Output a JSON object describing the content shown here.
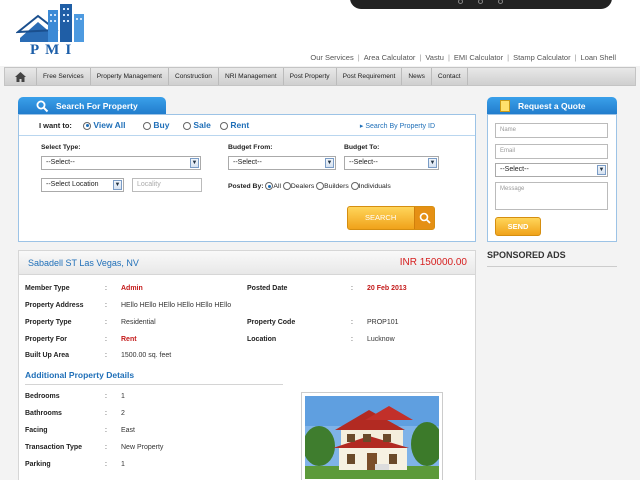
{
  "logo": {
    "text": "PMI"
  },
  "top_links": [
    "Our Services",
    "Area Calculator",
    "Vastu",
    "EMI Calculator",
    "Stamp Calculator",
    "Loan Shell"
  ],
  "nav": {
    "home_icon": "home-icon",
    "items": [
      "Free Services",
      "Property Management",
      "Construction",
      "NRI Management",
      "Post Property",
      "Post Requirement",
      "News",
      "Contact"
    ]
  },
  "search": {
    "tab_title": "Search For Property",
    "i_want_label": "I want to:",
    "options": [
      "View All",
      "Buy",
      "Sale",
      "Rent"
    ],
    "selected_option": "View All",
    "by_id_link": "Search By Property ID",
    "select_type_label": "Select Type:",
    "select_type_value": "--Select--",
    "budget_from_label": "Budget From:",
    "budget_from_value": "--Select--",
    "budget_to_label": "Budget To:",
    "budget_to_value": "--Select--",
    "location_value": "--Select Location",
    "locality_placeholder": "Locality",
    "posted_by_label": "Posted By:",
    "posted_by_options": [
      "All",
      "Dealers",
      "Builders",
      "Individuals"
    ],
    "posted_by_selected": "All",
    "search_button": "SEARCH"
  },
  "quote": {
    "tab_title": "Request a Quote",
    "name_placeholder": "Name",
    "email_placeholder": "Email",
    "select_value": "--Select--",
    "message_placeholder": "Message",
    "send_button": "SEND"
  },
  "sponsored_title": "SPONSORED ADS",
  "listing": {
    "title": "Sabadell ST Las Vegas, NV",
    "price": "INR 150000.00",
    "details": [
      {
        "k": "Member Type",
        "v": "Admin",
        "k2": "Posted Date",
        "v2": "20 Feb 2013"
      },
      {
        "k": "Property Address",
        "v": "HEllo HEllo HEllo HEllo HEllo HEllo",
        "k2": "",
        "v2": ""
      },
      {
        "k": "Property Type",
        "v": "Residential",
        "k2": "Property Code",
        "v2": "PROP101"
      },
      {
        "k": "Property For",
        "v": "Rent",
        "k2": "Location",
        "v2": "Lucknow"
      },
      {
        "k": "Built Up Area",
        "v": "1500.00 sq. feet",
        "k2": "",
        "v2": ""
      }
    ],
    "additional_title": "Additional Property Details",
    "additional": [
      {
        "k": "Bedrooms",
        "v": "1"
      },
      {
        "k": "Bathrooms",
        "v": "2"
      },
      {
        "k": "Facing",
        "v": "East"
      },
      {
        "k": "Transaction Type",
        "v": "New Property"
      },
      {
        "k": "Parking",
        "v": "1"
      }
    ]
  },
  "colors": {
    "accent_blue": "#1f79c9",
    "button_orange": "#f0a21a",
    "highlight_red": "#c41a1a"
  }
}
